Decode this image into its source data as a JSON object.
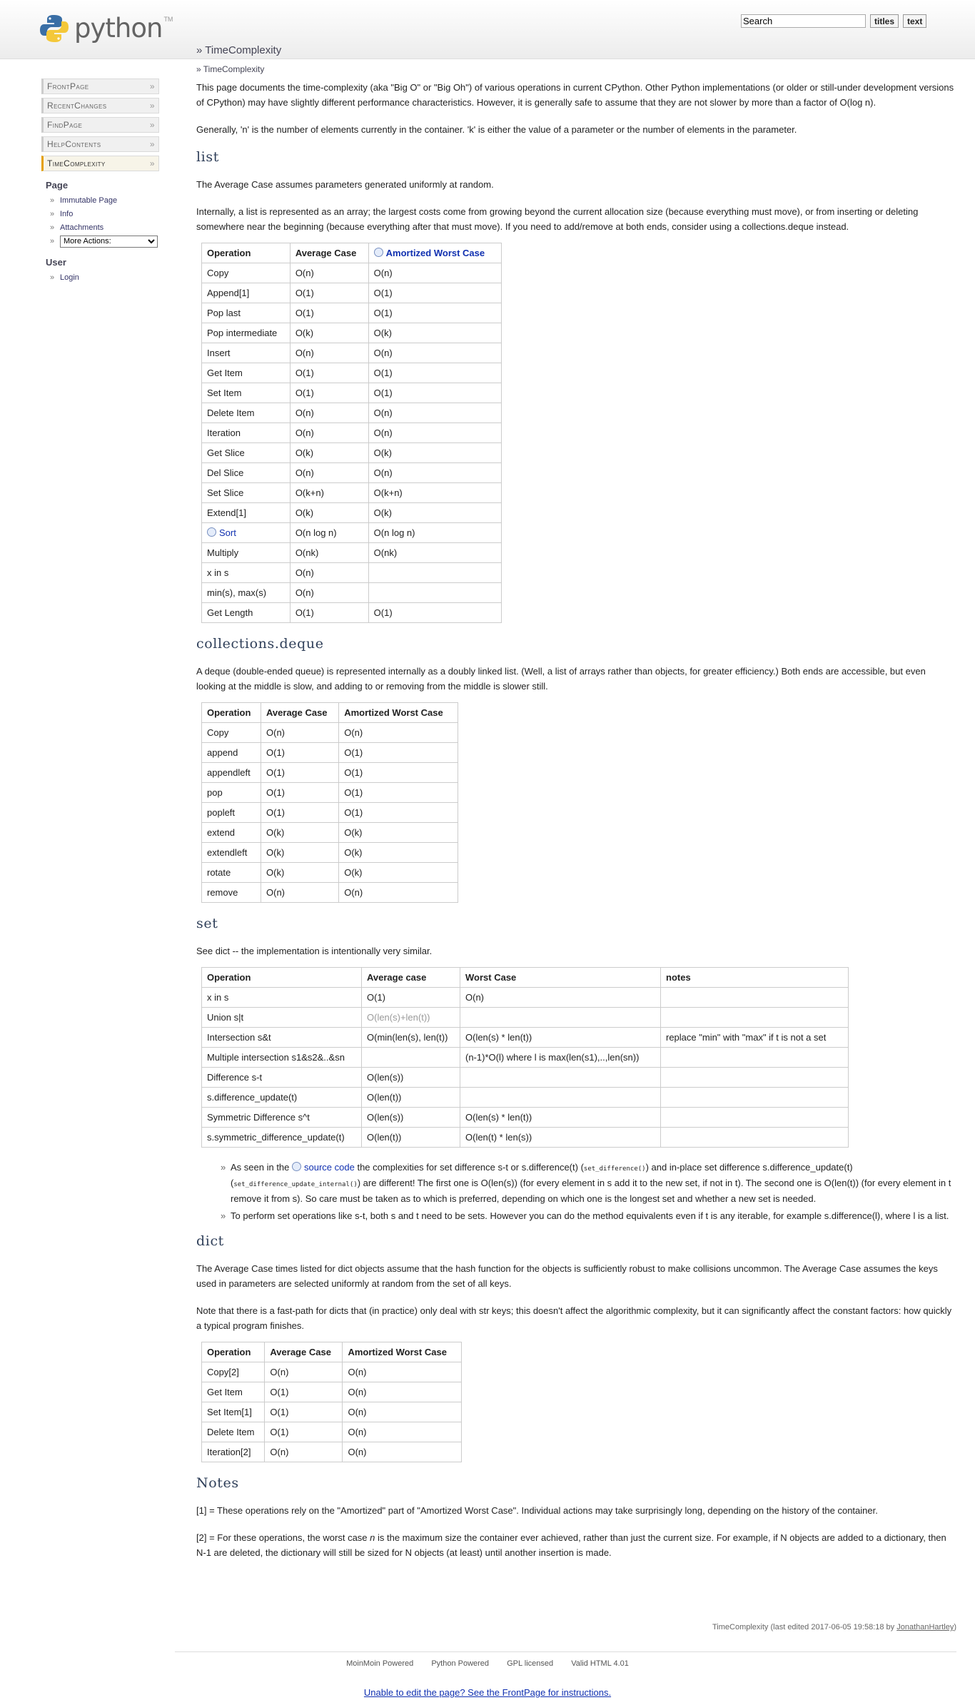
{
  "header": {
    "logo_text": "python",
    "logo_tm": "TM",
    "search_value": "Search",
    "titles_button": "titles",
    "text_button": "text"
  },
  "breadcrumb": {
    "main": "TimeComplexity",
    "trail": "TimeComplexity"
  },
  "sidebar": {
    "nav": [
      {
        "label": "FrontPage"
      },
      {
        "label": "RecentChanges"
      },
      {
        "label": "FindPage"
      },
      {
        "label": "HelpContents"
      },
      {
        "label": "TimeComplexity"
      }
    ],
    "page_heading": "Page",
    "page_links": [
      {
        "label": "Immutable Page"
      },
      {
        "label": "Info"
      },
      {
        "label": "Attachments"
      }
    ],
    "more_actions": "More Actions:",
    "user_heading": "User",
    "user_links": [
      {
        "label": "Login"
      }
    ]
  },
  "intro": {
    "p1": "This page documents the time-complexity (aka \"Big O\" or \"Big Oh\") of various operations in current CPython. Other Python implementations (or older or still-under development versions of CPython) may have slightly different performance characteristics. However, it is generally safe to assume that they are not slower by more than a factor of O(log n).",
    "p2": "Generally, 'n' is the number of elements currently in the container. 'k' is either the value of a parameter or the number of elements in the parameter."
  },
  "list_section": {
    "heading": "list",
    "p1": "The Average Case assumes parameters generated uniformly at random.",
    "p2": "Internally, a list is represented as an array; the largest costs come from growing beyond the current allocation size (because everything must move), or from inserting or deleting somewhere near the beginning (because everything after that must move). If you need to add/remove at both ends, consider using a collections.deque instead.",
    "headers": [
      "Operation",
      "Average Case",
      "Amortized Worst Case"
    ],
    "rows": [
      [
        "Copy",
        "O(n)",
        "O(n)"
      ],
      [
        "Append[1]",
        "O(1)",
        "O(1)"
      ],
      [
        "Pop last",
        "O(1)",
        "O(1)"
      ],
      [
        "Pop intermediate",
        "O(k)",
        "O(k)"
      ],
      [
        "Insert",
        "O(n)",
        "O(n)"
      ],
      [
        "Get Item",
        "O(1)",
        "O(1)"
      ],
      [
        "Set Item",
        "O(1)",
        "O(1)"
      ],
      [
        "Delete Item",
        "O(n)",
        "O(n)"
      ],
      [
        "Iteration",
        "O(n)",
        "O(n)"
      ],
      [
        "Get Slice",
        "O(k)",
        "O(k)"
      ],
      [
        "Del Slice",
        "O(n)",
        "O(n)"
      ],
      [
        "Set Slice",
        "O(k+n)",
        "O(k+n)"
      ],
      [
        "Extend[1]",
        "O(k)",
        "O(k)"
      ],
      [
        "Sort",
        "O(n log n)",
        "O(n log n)"
      ],
      [
        "Multiply",
        "O(nk)",
        "O(nk)"
      ],
      [
        "x in s",
        "O(n)",
        ""
      ],
      [
        "min(s), max(s)",
        "O(n)",
        ""
      ],
      [
        "Get Length",
        "O(1)",
        "O(1)"
      ]
    ]
  },
  "deque_section": {
    "heading": "collections.deque",
    "p1": "A deque (double-ended queue) is represented internally as a doubly linked list. (Well, a list of arrays rather than objects, for greater efficiency.) Both ends are accessible, but even looking at the middle is slow, and adding to or removing from the middle is slower still.",
    "headers": [
      "Operation",
      "Average Case",
      "Amortized Worst Case"
    ],
    "rows": [
      [
        "Copy",
        "O(n)",
        "O(n)"
      ],
      [
        "append",
        "O(1)",
        "O(1)"
      ],
      [
        "appendleft",
        "O(1)",
        "O(1)"
      ],
      [
        "pop",
        "O(1)",
        "O(1)"
      ],
      [
        "popleft",
        "O(1)",
        "O(1)"
      ],
      [
        "extend",
        "O(k)",
        "O(k)"
      ],
      [
        "extendleft",
        "O(k)",
        "O(k)"
      ],
      [
        "rotate",
        "O(k)",
        "O(k)"
      ],
      [
        "remove",
        "O(n)",
        "O(n)"
      ]
    ]
  },
  "set_section": {
    "heading": "set",
    "p1": "See dict -- the implementation is intentionally very similar.",
    "headers": [
      "Operation",
      "Average case",
      "Worst Case",
      "notes"
    ],
    "rows": [
      [
        "x in s",
        "O(1)",
        "O(n)",
        ""
      ],
      [
        "Union s|t",
        "O(len(s)+len(t))",
        "",
        ""
      ],
      [
        "Intersection s&t",
        "O(min(len(s), len(t))",
        "O(len(s) * len(t))",
        "replace \"min\" with \"max\" if t is not a set"
      ],
      [
        "Multiple intersection s1&s2&..&sn",
        "",
        "(n-1)*O(l) where l is max(len(s1),..,len(sn))",
        ""
      ],
      [
        "Difference s-t",
        "O(len(s))",
        "",
        ""
      ],
      [
        "s.difference_update(t)",
        "O(len(t))",
        "",
        ""
      ],
      [
        "Symmetric Difference s^t",
        "O(len(s))",
        "O(len(s) * len(t))",
        ""
      ],
      [
        "s.symmetric_difference_update(t)",
        "O(len(t))",
        "O(len(t) * len(s))",
        ""
      ]
    ],
    "b1_pre": "As seen in the",
    "b1_link": "source code",
    "b1_mid1": "the complexities for set difference s-t or s.difference(t) (",
    "b1_code1": "set_difference()",
    "b1_mid2": ") and in-place set difference s.difference_update(t) (",
    "b1_code2": "set_difference_update_internal()",
    "b1_post": ") are different! The first one is O(len(s)) (for every element in s add it to the new set, if not in t). The second one is O(len(t)) (for every element in t remove it from s). So care must be taken as to which is preferred, depending on which one is the longest set and whether a new set is needed.",
    "b2": "To perform set operations like s-t, both s and t need to be sets. However you can do the method equivalents even if t is any iterable, for example s.difference(l), where l is a list."
  },
  "dict_section": {
    "heading": "dict",
    "p1": "The Average Case times listed for dict objects assume that the hash function for the objects is sufficiently robust to make collisions uncommon. The Average Case assumes the keys used in parameters are selected uniformly at random from the set of all keys.",
    "p2": "Note that there is a fast-path for dicts that (in practice) only deal with str keys; this doesn't affect the algorithmic complexity, but it can significantly affect the constant factors: how quickly a typical program finishes.",
    "headers": [
      "Operation",
      "Average Case",
      "Amortized Worst Case"
    ],
    "rows": [
      [
        "Copy[2]",
        "O(n)",
        "O(n)"
      ],
      [
        "Get Item",
        "O(1)",
        "O(n)"
      ],
      [
        "Set Item[1]",
        "O(1)",
        "O(n)"
      ],
      [
        "Delete Item",
        "O(1)",
        "O(n)"
      ],
      [
        "Iteration[2]",
        "O(n)",
        "O(n)"
      ]
    ]
  },
  "notes_section": {
    "heading": "Notes",
    "n1": "[1] = These operations rely on the \"Amortized\" part of \"Amortized Worst Case\". Individual actions may take surprisingly long, depending on the history of the container.",
    "n2_pre": "[2] = For these operations, the worst case ",
    "n2_em": "n",
    "n2_post": " is the maximum size the container ever achieved, rather than just the current size. For example, if N objects are added to a dictionary, then N-1 are deleted, the dictionary will still be sized for N objects (at least) until another insertion is made."
  },
  "footer": {
    "pageinfo_pre": "TimeComplexity (last edited 2017-06-05 19:58:18 by ",
    "pageinfo_author": "JonathanHartley",
    "pageinfo_post": ")",
    "credits": [
      "MoinMoin Powered",
      "Python Powered",
      "GPL licensed",
      "Valid HTML 4.01"
    ],
    "edit_link": "Unable to edit the page? See the FrontPage for instructions."
  }
}
